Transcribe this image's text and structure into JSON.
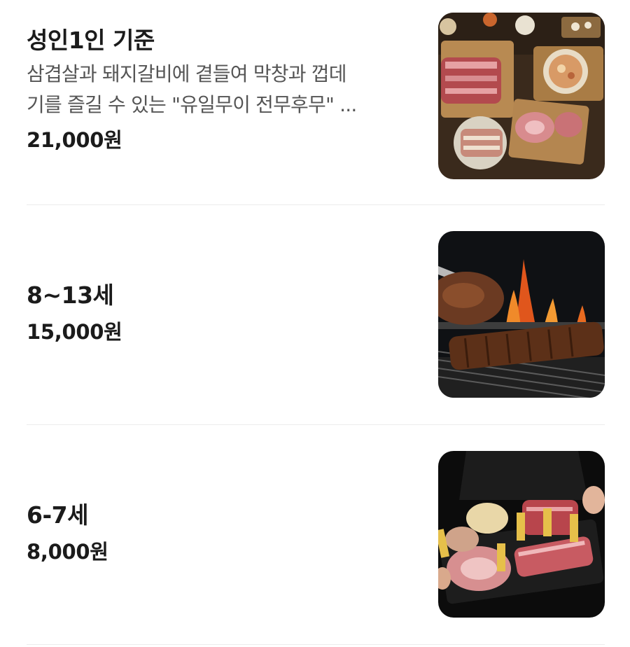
{
  "menu": {
    "items": [
      {
        "title": "성인1인 기준",
        "description_line1": "삼겹살과 돼지갈비에 곁들여 막창과 껍데",
        "description_line2": "기를 즐길 수 있는 \"유일무이 전무후무\" ...",
        "price": "21,000원",
        "image": "meat-platter-spread-image"
      },
      {
        "title": "8~13세",
        "price": "15,000원",
        "image": "ribs-on-grill-image"
      },
      {
        "title": "6-7세",
        "price": "8,000원",
        "image": "meat-tray-image"
      }
    ]
  }
}
